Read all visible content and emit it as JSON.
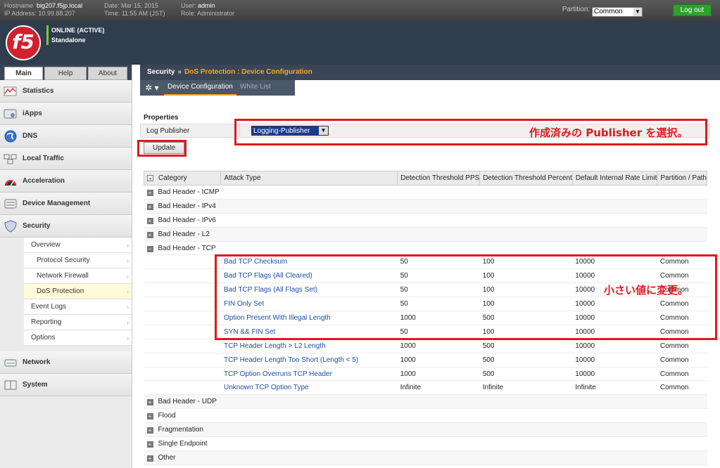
{
  "topbar": {
    "hostname_label": "Hostname",
    "hostname": "big207.f5jp.local",
    "ip_label": "IP Address:",
    "ip": "10.99.88.207",
    "date_label": "Date:",
    "date": "Mar 15, 2015",
    "time_label": "Time:",
    "time": "11:55 AM (JST)",
    "user_label": "User:",
    "user": "admin",
    "role_label": "Role:",
    "role": "Administrator",
    "partition_label": "Partition:",
    "partition_value": "Common",
    "logout": "Log out"
  },
  "banner": {
    "logo": "f5",
    "status1": "ONLINE (ACTIVE)",
    "status2": "Standalone"
  },
  "sidebar": {
    "tabs": [
      "Main",
      "Help",
      "About"
    ],
    "sections_top": [
      {
        "label": "Statistics",
        "icon": "statistics-icon"
      },
      {
        "label": "iApps",
        "icon": "iapps-icon"
      },
      {
        "label": "DNS",
        "icon": "dns-icon"
      },
      {
        "label": "Local Traffic",
        "icon": "local-traffic-icon"
      },
      {
        "label": "Acceleration",
        "icon": "acceleration-icon"
      },
      {
        "label": "Device Management",
        "icon": "device-management-icon"
      },
      {
        "label": "Security",
        "icon": "security-shield-icon"
      }
    ],
    "security_items": [
      {
        "label": "Overview"
      },
      {
        "label": "Protocol Security"
      },
      {
        "label": "Network Firewall"
      },
      {
        "label": "DoS Protection"
      },
      {
        "label": "Event Logs"
      },
      {
        "label": "Reporting"
      },
      {
        "label": "Options"
      }
    ],
    "sections_bottom": [
      {
        "label": "Network",
        "icon": "network-icon"
      },
      {
        "label": "System",
        "icon": "system-icon"
      }
    ]
  },
  "main": {
    "breadcrumb": {
      "root": "Security",
      "sep": "»",
      "current": "DoS Protection : Device Configuration"
    },
    "tabs": [
      "Device Configuration",
      "White List"
    ],
    "properties_title": "Properties",
    "log_publisher_label": "Log Publisher",
    "log_publisher_value": "Logging-Publisher",
    "update": "Update",
    "annotation1": "作成済みの Publisher を選択。",
    "annotation2": "小さい値に変更。",
    "columns": [
      "Category",
      "Attack Type",
      "Detection Threshold PPS",
      "Detection Threshold Percent",
      "Default Internal Rate Limit",
      "Partition / Path"
    ],
    "cat_rows_before": [
      "Bad Header - ICMP",
      "Bad Header - IPv4",
      "Bad Header - IPv6",
      "Bad Header - L2",
      "Bad Header - TCP"
    ],
    "attacks": [
      {
        "name": "Bad TCP Checksum",
        "pps": "50",
        "pct": "100",
        "rate": "10000",
        "path": "Common"
      },
      {
        "name": "Bad TCP Flags (All Cleared)",
        "pps": "50",
        "pct": "100",
        "rate": "10000",
        "path": "Common"
      },
      {
        "name": "Bad TCP Flags (All Flags Set)",
        "pps": "50",
        "pct": "100",
        "rate": "10000",
        "path": "Common"
      },
      {
        "name": "FIN Only Set",
        "pps": "50",
        "pct": "100",
        "rate": "10000",
        "path": "Common"
      },
      {
        "name": "Option Present With Illegal Length",
        "pps": "1000",
        "pct": "500",
        "rate": "10000",
        "path": "Common"
      },
      {
        "name": "SYN && FIN Set",
        "pps": "50",
        "pct": "100",
        "rate": "10000",
        "path": "Common"
      },
      {
        "name": "TCP Header Length > L2 Length",
        "pps": "1000",
        "pct": "500",
        "rate": "10000",
        "path": "Common"
      },
      {
        "name": "TCP Header Length Too Short (Length < 5)",
        "pps": "1000",
        "pct": "500",
        "rate": "10000",
        "path": "Common"
      },
      {
        "name": "TCP Option Overruns TCP Header",
        "pps": "1000",
        "pct": "500",
        "rate": "10000",
        "path": "Common"
      },
      {
        "name": "Unknown TCP Option Type",
        "pps": "Infinite",
        "pct": "Infinite",
        "rate": "Infinite",
        "path": "Common"
      }
    ],
    "cat_rows_after": [
      "Bad Header - UDP",
      "Flood",
      "Fragmentation",
      "Single Endpoint",
      "Other"
    ]
  }
}
